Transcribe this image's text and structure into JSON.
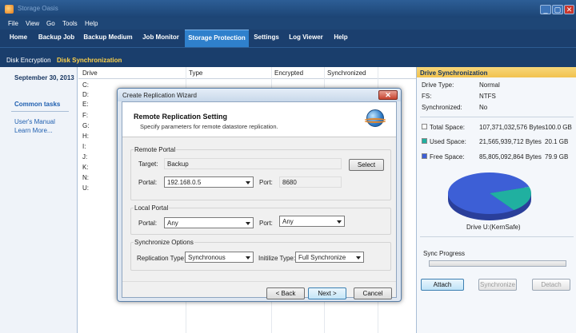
{
  "window": {
    "title": "Storage Oasis",
    "min": "_",
    "max": "▢",
    "close": "✕"
  },
  "menu": [
    "File",
    "View",
    "Go",
    "Tools",
    "Help"
  ],
  "tabs": [
    "Home",
    "Backup Job",
    "Backup Medium",
    "Job Monitor",
    "Storage Protection",
    "Settings",
    "Log Viewer",
    "Help"
  ],
  "active_tab": "Storage Protection",
  "subtabs": [
    "Disk Encryption",
    "Disk Synchronization"
  ],
  "left": {
    "date": "September 30, 2013",
    "common_tasks": "Common tasks",
    "links": [
      "User's Manual",
      "Learn More..."
    ]
  },
  "grid": {
    "headers": [
      "Drive",
      "Type",
      "Encrypted",
      "Synchronized"
    ],
    "drives": [
      "C:",
      "D:",
      "E:",
      "F:",
      "G:",
      "H:",
      "I:",
      "J:",
      "K:",
      "N:",
      "U:"
    ]
  },
  "right": {
    "header": "Drive Synchronization",
    "info": [
      {
        "label": "Drive Type:",
        "value": "Normal"
      },
      {
        "label": "FS:",
        "value": "NTFS"
      },
      {
        "label": "Synchronized:",
        "value": "No"
      }
    ],
    "space": [
      {
        "label": "Total Space:",
        "bytes": "107,371,032,576 Bytes",
        "gb": "100.0 GB",
        "color": "#ffffff"
      },
      {
        "label": "Used Space:",
        "bytes": "21,565,939,712 Bytes",
        "gb": "20.1 GB",
        "color": "#20b0a0"
      },
      {
        "label": "Free Space:",
        "bytes": "85,805,092,864 Bytes",
        "gb": "79.9 GB",
        "color": "#3d5fd6"
      }
    ],
    "used_fraction": 0.201,
    "pie_caption": "Drive U:(KernSafe)",
    "sync_progress_label": "Sync Progress",
    "sync_progress_value": 0,
    "buttons": {
      "attach": "Attach",
      "synchronize": "Synchronize",
      "detach": "Detach"
    }
  },
  "dialog": {
    "title": "Create Replication Wizard",
    "close": "✕",
    "heading": "Remote Replication Setting",
    "subheading": "Specify parameters for remote datastore replication.",
    "remote": {
      "group": "Remote Portal",
      "target_label": "Target:",
      "target_value": "Backup",
      "select_button": "Select",
      "portal_label": "Portal:",
      "portal_value": "192.168.0.5",
      "port_label": "Port:",
      "port_value": "8680"
    },
    "local": {
      "group": "Local Portal",
      "portal_label": "Portal:",
      "portal_value": "Any",
      "port_label": "Port:",
      "port_value": "Any"
    },
    "sync": {
      "group": "Synchronize Options",
      "type_label": "Replication Type:",
      "type_value": "Synchronous",
      "init_label": "Initilize Type:",
      "init_value": "Full Synchronize"
    },
    "buttons": {
      "back": "< Back",
      "next": "Next >",
      "cancel": "Cancel"
    }
  }
}
